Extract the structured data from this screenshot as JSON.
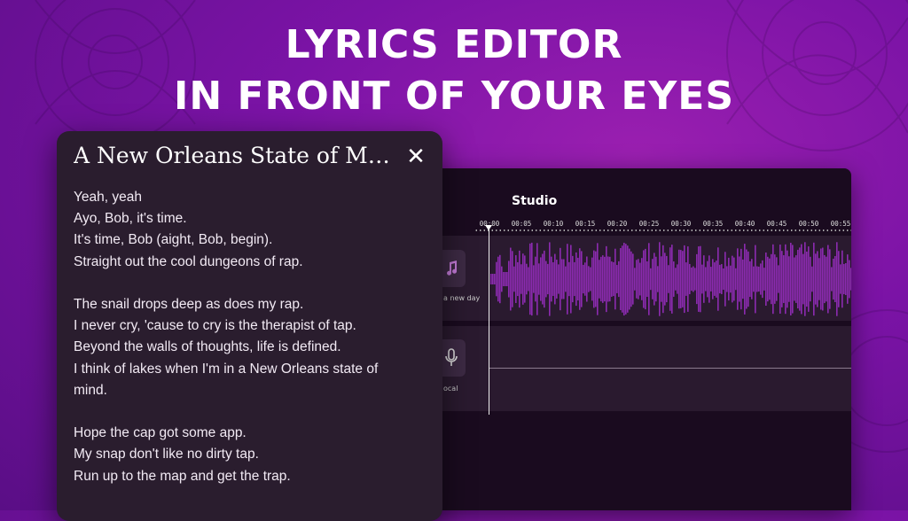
{
  "headline": {
    "line1": "LYRICS EDITOR",
    "line2": "IN FRONT OF YOUR EYES"
  },
  "colors": {
    "background": "#7b13a6",
    "panel": "#2a1d2e",
    "waveform": "#8c2bb0",
    "text": "#ffffff"
  },
  "lyrics_panel": {
    "title": "A New Orleans State of M…",
    "close_icon": "close-icon",
    "lines": [
      "Yeah, yeah",
      "Ayo, Bob, it's time.",
      "It's time, Bob (aight, Bob, begin).",
      "Straight out the cool dungeons of rap.",
      "",
      "The snail drops deep as does my rap.",
      "I never cry, 'cause to cry is the therapist of tap.",
      "Beyond the walls of thoughts, life is defined.",
      "I think of lakes when I'm in a New Orleans state of",
      "mind.",
      "",
      "Hope the cap got some app.",
      "My snap don't like no dirty tap.",
      "Run up to the map and get the trap."
    ]
  },
  "studio": {
    "title": "Studio",
    "timeline": [
      "00:00",
      "00:05",
      "00:10",
      "00:15",
      "00:20",
      "00:25",
      "00:30",
      "00:35",
      "00:40",
      "00:45",
      "00:50",
      "00:55"
    ],
    "tracks": [
      {
        "label": "a new day",
        "icon": "music-note-icon"
      },
      {
        "label": "ocal",
        "icon": "microphone-icon"
      }
    ]
  }
}
